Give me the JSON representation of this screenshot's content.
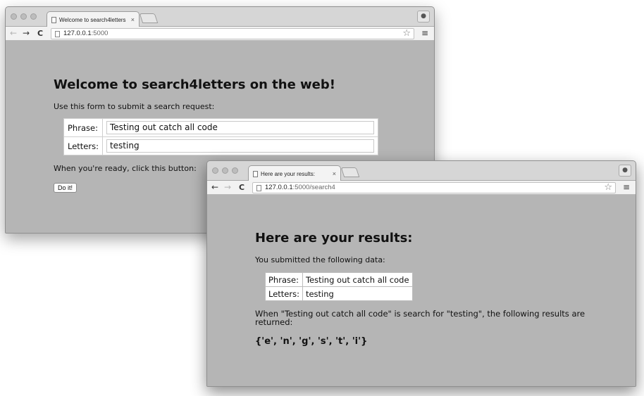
{
  "window1": {
    "tab_title": "Welcome to search4letters",
    "tab_close": "×",
    "url_host": "127.0.0.1",
    "url_rest": ":5000",
    "heading": "Welcome to search4letters on the web!",
    "intro": "Use this form to submit a search request:",
    "form": {
      "phrase_label": "Phrase:",
      "phrase_value": "Testing out catch all code",
      "letters_label": "Letters:",
      "letters_value": "testing"
    },
    "ready_text": "When you're ready, click this button:",
    "button_label": "Do it!"
  },
  "window2": {
    "tab_title": "Here are your results:",
    "tab_close": "×",
    "url_host": "127.0.0.1",
    "url_rest": ":5000/search4",
    "heading": "Here are your results:",
    "intro": "You submitted the following data:",
    "table": {
      "phrase_label": "Phrase:",
      "phrase_value": "Testing out catch all code",
      "letters_label": "Letters:",
      "letters_value": "testing"
    },
    "result_sentence": "When \"Testing out catch all code\" is search for \"testing\", the following results are returned:",
    "result_value": "{'e', 'n', 'g', 's', 't', 'i'}"
  },
  "icons": {
    "back": "←",
    "forward": "→",
    "reload": "C",
    "star": "☆",
    "menu": "≡",
    "user": "👤"
  }
}
